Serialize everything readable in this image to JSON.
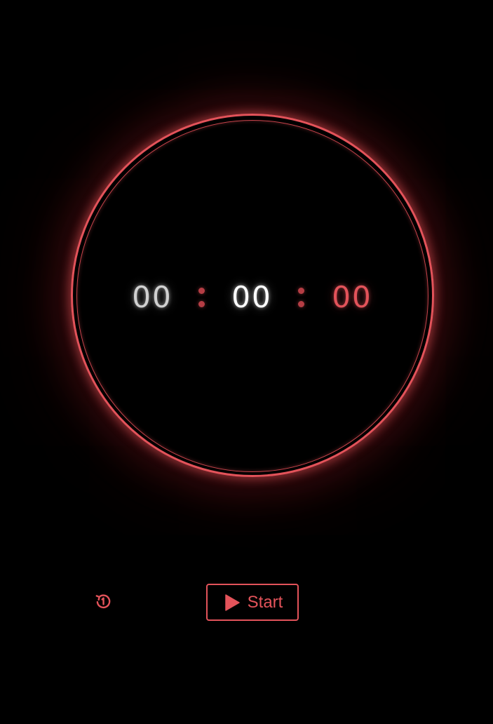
{
  "timer": {
    "hours": "00",
    "minutes": "00",
    "seconds": "00"
  },
  "controls": {
    "reset_icon": "history-icon",
    "start_icon": "play-icon",
    "start_label": "Start"
  },
  "colors": {
    "background": "#000000",
    "accent": "#e3535a",
    "hours_digits": "#d0d0d0",
    "minutes_digits": "#ffffff",
    "seconds_digits": "#e3535a",
    "separator": "#b53d44"
  }
}
